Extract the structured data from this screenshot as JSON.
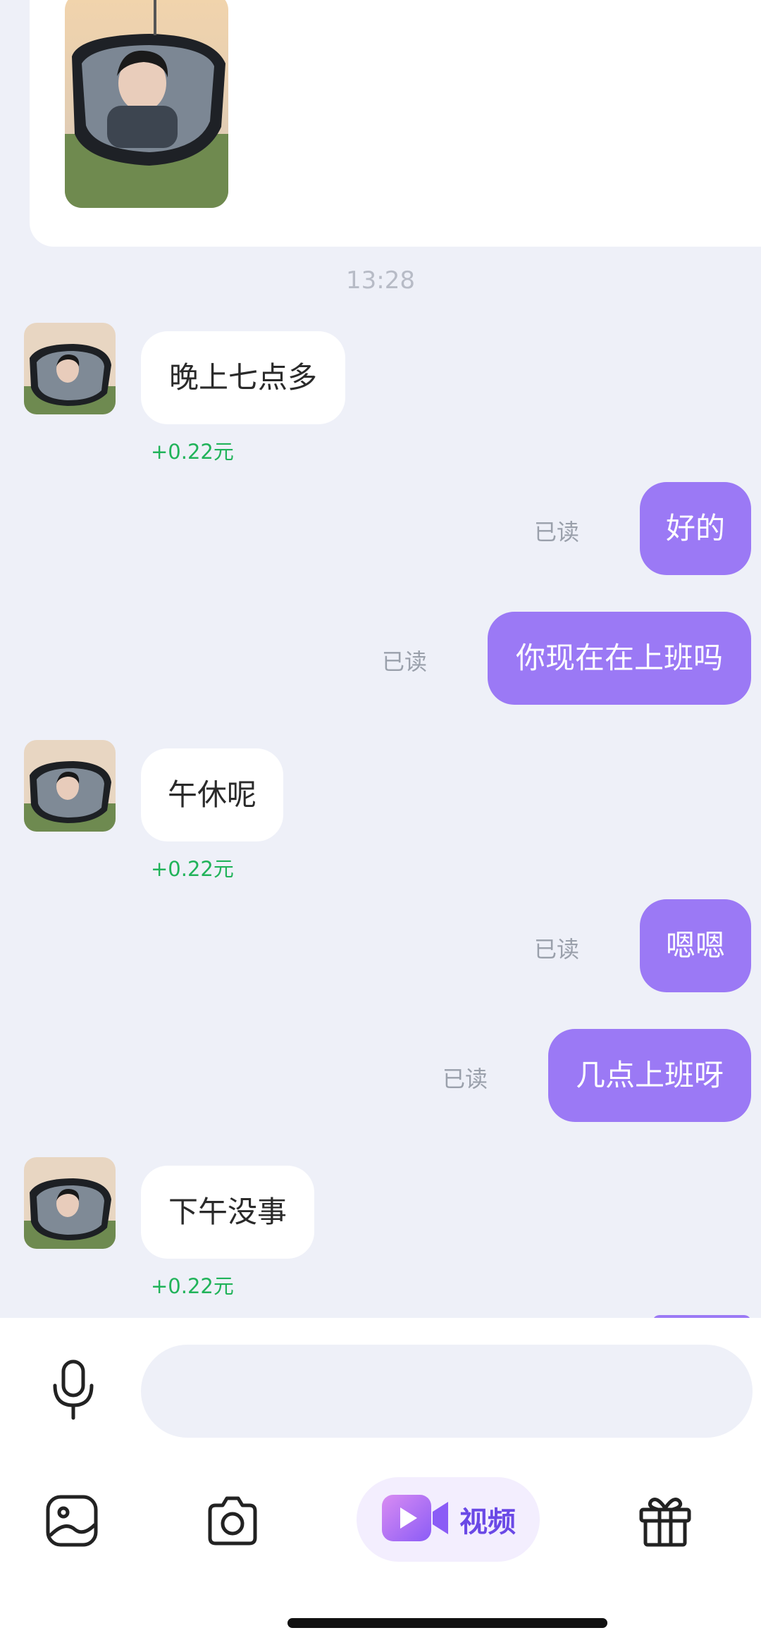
{
  "chat": {
    "timestamp": "13:28",
    "messages": [
      {
        "side": "in",
        "text": "晚上七点多",
        "reward": "+0.22元"
      },
      {
        "side": "out",
        "text": "好的",
        "status": "已读"
      },
      {
        "side": "out",
        "text": "你现在在上班吗",
        "status": "已读"
      },
      {
        "side": "in",
        "text": "午休呢",
        "reward": "+0.22元"
      },
      {
        "side": "out",
        "text": "嗯嗯",
        "status": "已读"
      },
      {
        "side": "out",
        "text": "几点上班呀",
        "status": "已读"
      },
      {
        "side": "in",
        "text": "下午没事",
        "reward": "+0.22元"
      }
    ]
  },
  "toolbar": {
    "video_label": "视频",
    "icons": [
      "mic-icon",
      "album-icon",
      "camera-icon",
      "video-icon",
      "gift-icon"
    ]
  },
  "colors": {
    "accent": "#9b79f5",
    "reward": "#21b35a",
    "background": "#eef0f8"
  }
}
